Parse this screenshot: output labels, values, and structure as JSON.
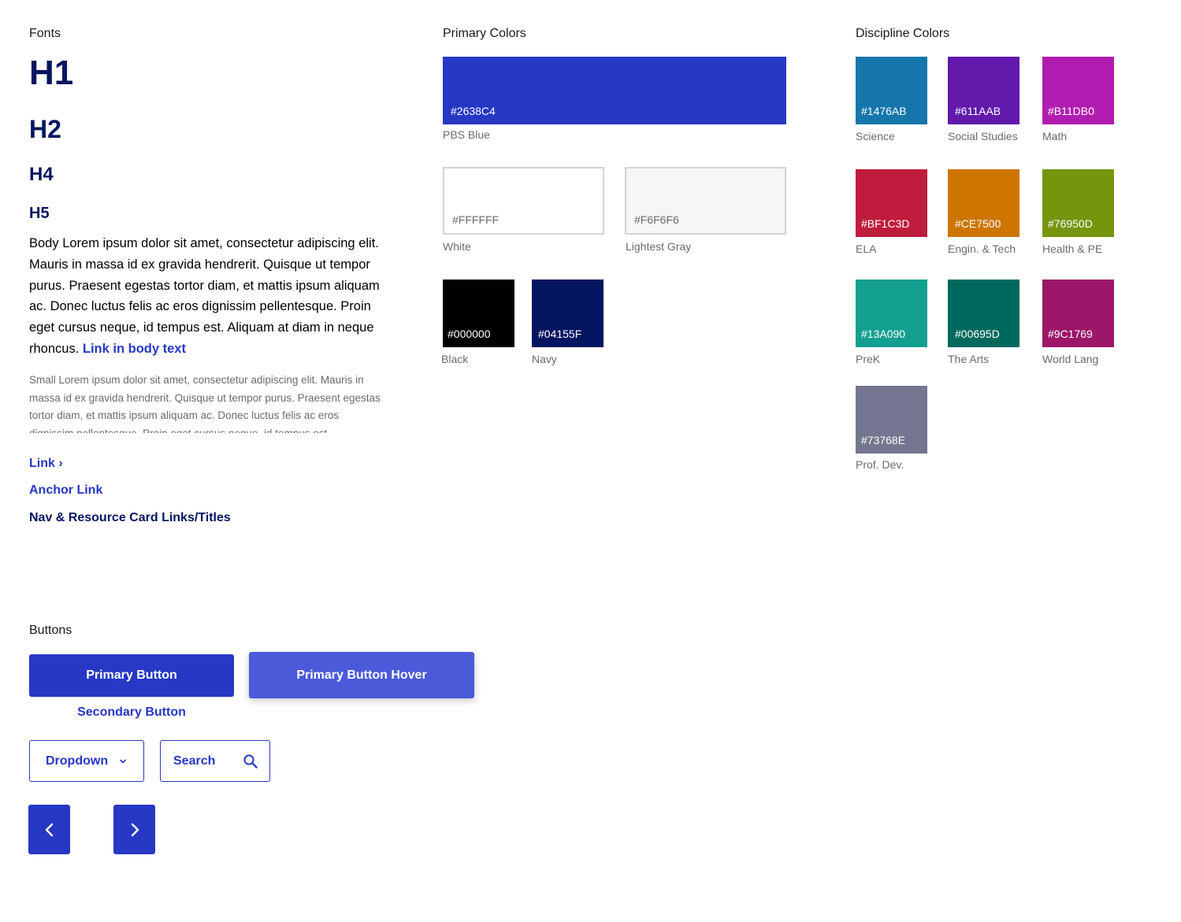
{
  "fonts": {
    "title": "Fonts",
    "h1": "H1",
    "h2": "H2",
    "h4": "H4",
    "h5": "H5",
    "body_text": "Body Lorem ipsum dolor sit amet, consectetur adipiscing elit. Mauris in massa id ex gravida hendrerit. Quisque ut tempor purus. Praesent egestas tortor diam, et mattis ipsum aliquam ac. Donec luctus felis ac eros dignissim pellentesque. Proin eget cursus neque, id tempus est. Aliquam at diam in neque rhoncus.",
    "body_link": "Link in body text",
    "small_text": "Small Lorem ipsum dolor sit amet, consectetur adipiscing elit. Mauris in massa id ex gravida hendrerit. Quisque ut tempor purus. Praesent egestas tortor diam, et mattis ipsum aliquam ac. Donec luctus felis ac eros dignissim pellentesque. Proin eget cursus neque, id tempus est.",
    "link": "Link",
    "link_chevron": "›",
    "anchor_link": "Anchor Link",
    "nav_link": "Nav & Resource Card Links/Titles"
  },
  "primary_colors": {
    "title": "Primary Colors",
    "swatches": [
      {
        "hex": "#2638C4",
        "label": "PBS Blue",
        "text_color": "#ffffff"
      },
      {
        "hex": "#FFFFFF",
        "label": "White",
        "text_color": "#6b6b6b"
      },
      {
        "hex": "#F6F6F6",
        "label": "Lightest Gray",
        "text_color": "#6b6b6b"
      },
      {
        "hex": "#000000",
        "label": "Black",
        "text_color": "#ffffff"
      },
      {
        "hex": "#04155F",
        "label": "Navy",
        "text_color": "#ffffff"
      }
    ]
  },
  "discipline_colors": {
    "title": "Discipline Colors",
    "swatches": [
      {
        "hex": "#1476AB",
        "label": "Science"
      },
      {
        "hex": "#611AAB",
        "label": "Social Studies"
      },
      {
        "hex": "#B11DB0",
        "label": "Math"
      },
      {
        "hex": "#BF1C3D",
        "label": "ELA"
      },
      {
        "hex": "#CE7500",
        "label": "Engin. & Tech"
      },
      {
        "hex": "#76950D",
        "label": "Health & PE"
      },
      {
        "hex": "#13A090",
        "label": "PreK"
      },
      {
        "hex": "#00695D",
        "label": "The Arts"
      },
      {
        "hex": "#9C1769",
        "label": "World Lang"
      },
      {
        "hex": "#73768E",
        "label": "Prof. Dev."
      }
    ]
  },
  "buttons": {
    "title": "Buttons",
    "primary": "Primary Button",
    "primary_hover": "Primary Button Hover",
    "secondary": "Secondary Button",
    "dropdown": "Dropdown",
    "search_placeholder": "Search",
    "prev_icon": "chevron-left-icon",
    "next_icon": "chevron-right-icon"
  }
}
